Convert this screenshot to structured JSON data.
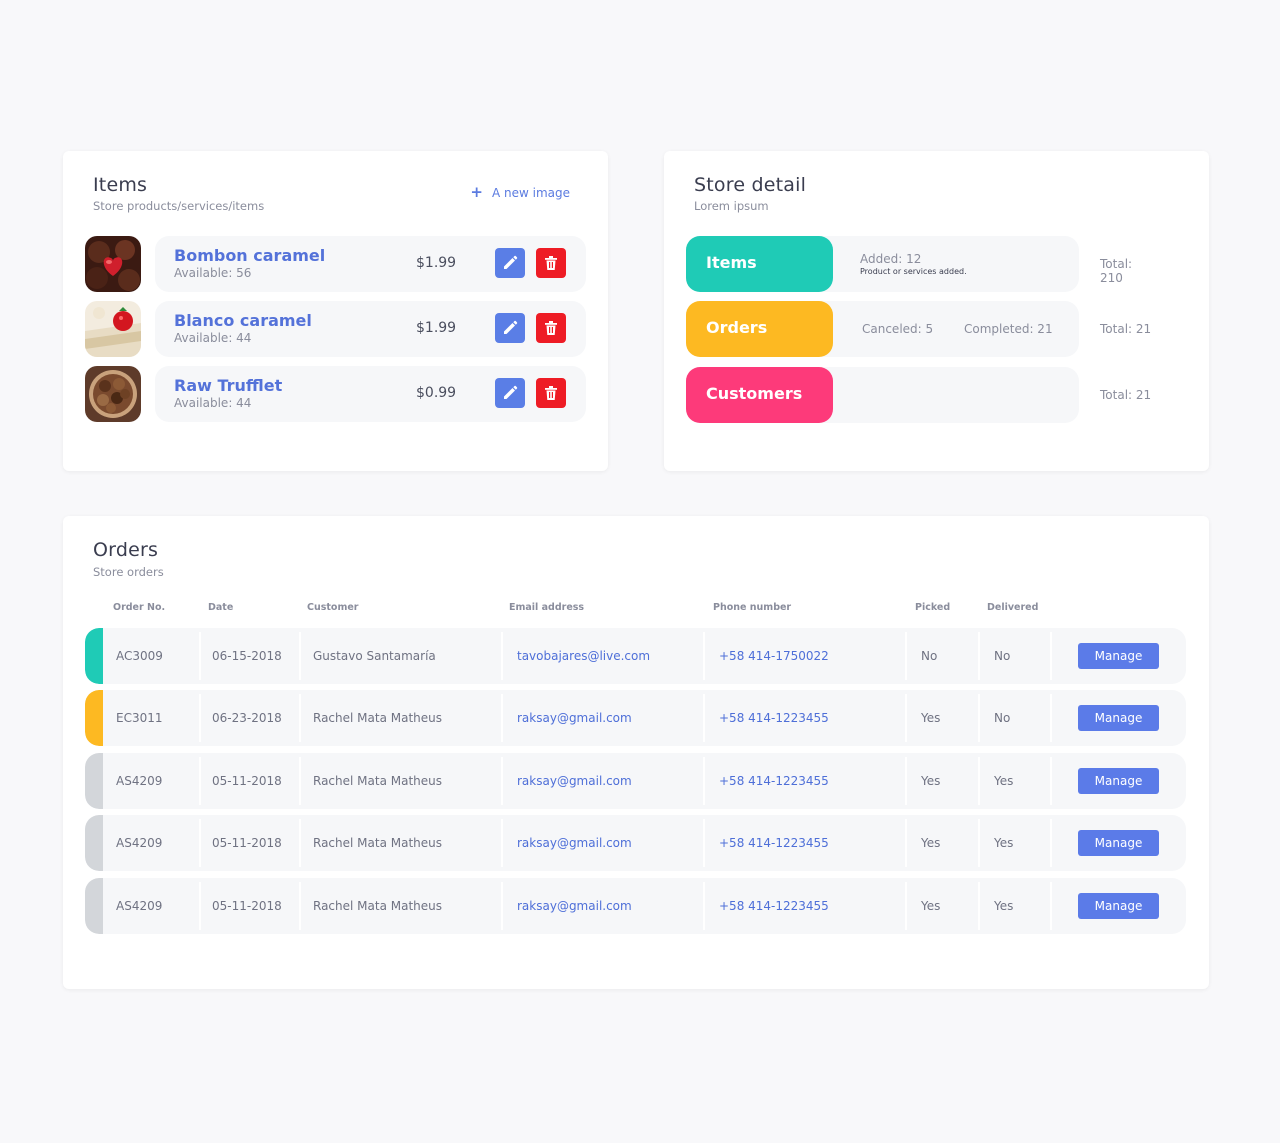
{
  "items_card": {
    "title": "Items",
    "subtitle": "Store products/services/items",
    "add_label": "A new image",
    "items": [
      {
        "name": "Bombon caramel",
        "available": "Available: 56",
        "price": "$1.99"
      },
      {
        "name": "Blanco caramel",
        "available": "Available: 44",
        "price": "$1.99"
      },
      {
        "name": "Raw Trufflet",
        "available": "Available: 44",
        "price": "$0.99"
      }
    ]
  },
  "store_card": {
    "title": "Store detail",
    "subtitle": "Lorem ipsum",
    "stats": [
      {
        "label": "Items",
        "color": "#1fcbb6",
        "added": "Added: 12",
        "note": "Product or services added.",
        "total": "Total: 210"
      },
      {
        "label": "Orders",
        "color": "#fdb922",
        "canceled": "Canceled: 5",
        "completed": "Completed: 21",
        "total": "Total: 21"
      },
      {
        "label": "Customers",
        "color": "#fd3a7a",
        "total": "Total: 21"
      }
    ]
  },
  "orders_card": {
    "title": "Orders",
    "subtitle": "Store orders",
    "columns": [
      "Order No.",
      "Date",
      "Customer",
      "Email address",
      "Phone number",
      "Picked",
      "Delivered"
    ],
    "manage_label": "Manage",
    "rows": [
      {
        "order": "AC3009",
        "date": "06-15-2018",
        "customer": "Gustavo Santamaría",
        "email": "tavobajares@live.com",
        "phone": "+58 414-1750022",
        "picked": "No",
        "delivered": "No",
        "status_color": "#1fcbb6"
      },
      {
        "order": "EC3011",
        "date": "06-23-2018",
        "customer": "Rachel Mata Matheus",
        "email": "raksay@gmail.com",
        "phone": "+58 414-1223455",
        "picked": "Yes",
        "delivered": "No",
        "status_color": "#fdb922"
      },
      {
        "order": "AS4209",
        "date": "05-11-2018",
        "customer": "Rachel Mata Matheus",
        "email": "raksay@gmail.com",
        "phone": "+58 414-1223455",
        "picked": "Yes",
        "delivered": "Yes",
        "status_color": "#d3d6da"
      },
      {
        "order": "AS4209",
        "date": "05-11-2018",
        "customer": "Rachel Mata Matheus",
        "email": "raksay@gmail.com",
        "phone": "+58 414-1223455",
        "picked": "Yes",
        "delivered": "Yes",
        "status_color": "#d3d6da"
      },
      {
        "order": "AS4209",
        "date": "05-11-2018",
        "customer": "Rachel Mata Matheus",
        "email": "raksay@gmail.com",
        "phone": "+58 414-1223455",
        "picked": "Yes",
        "delivered": "Yes",
        "status_color": "#d3d6da"
      }
    ]
  },
  "icons": {
    "add": "plus-icon",
    "edit": "pencil-icon",
    "delete": "trash-icon"
  }
}
